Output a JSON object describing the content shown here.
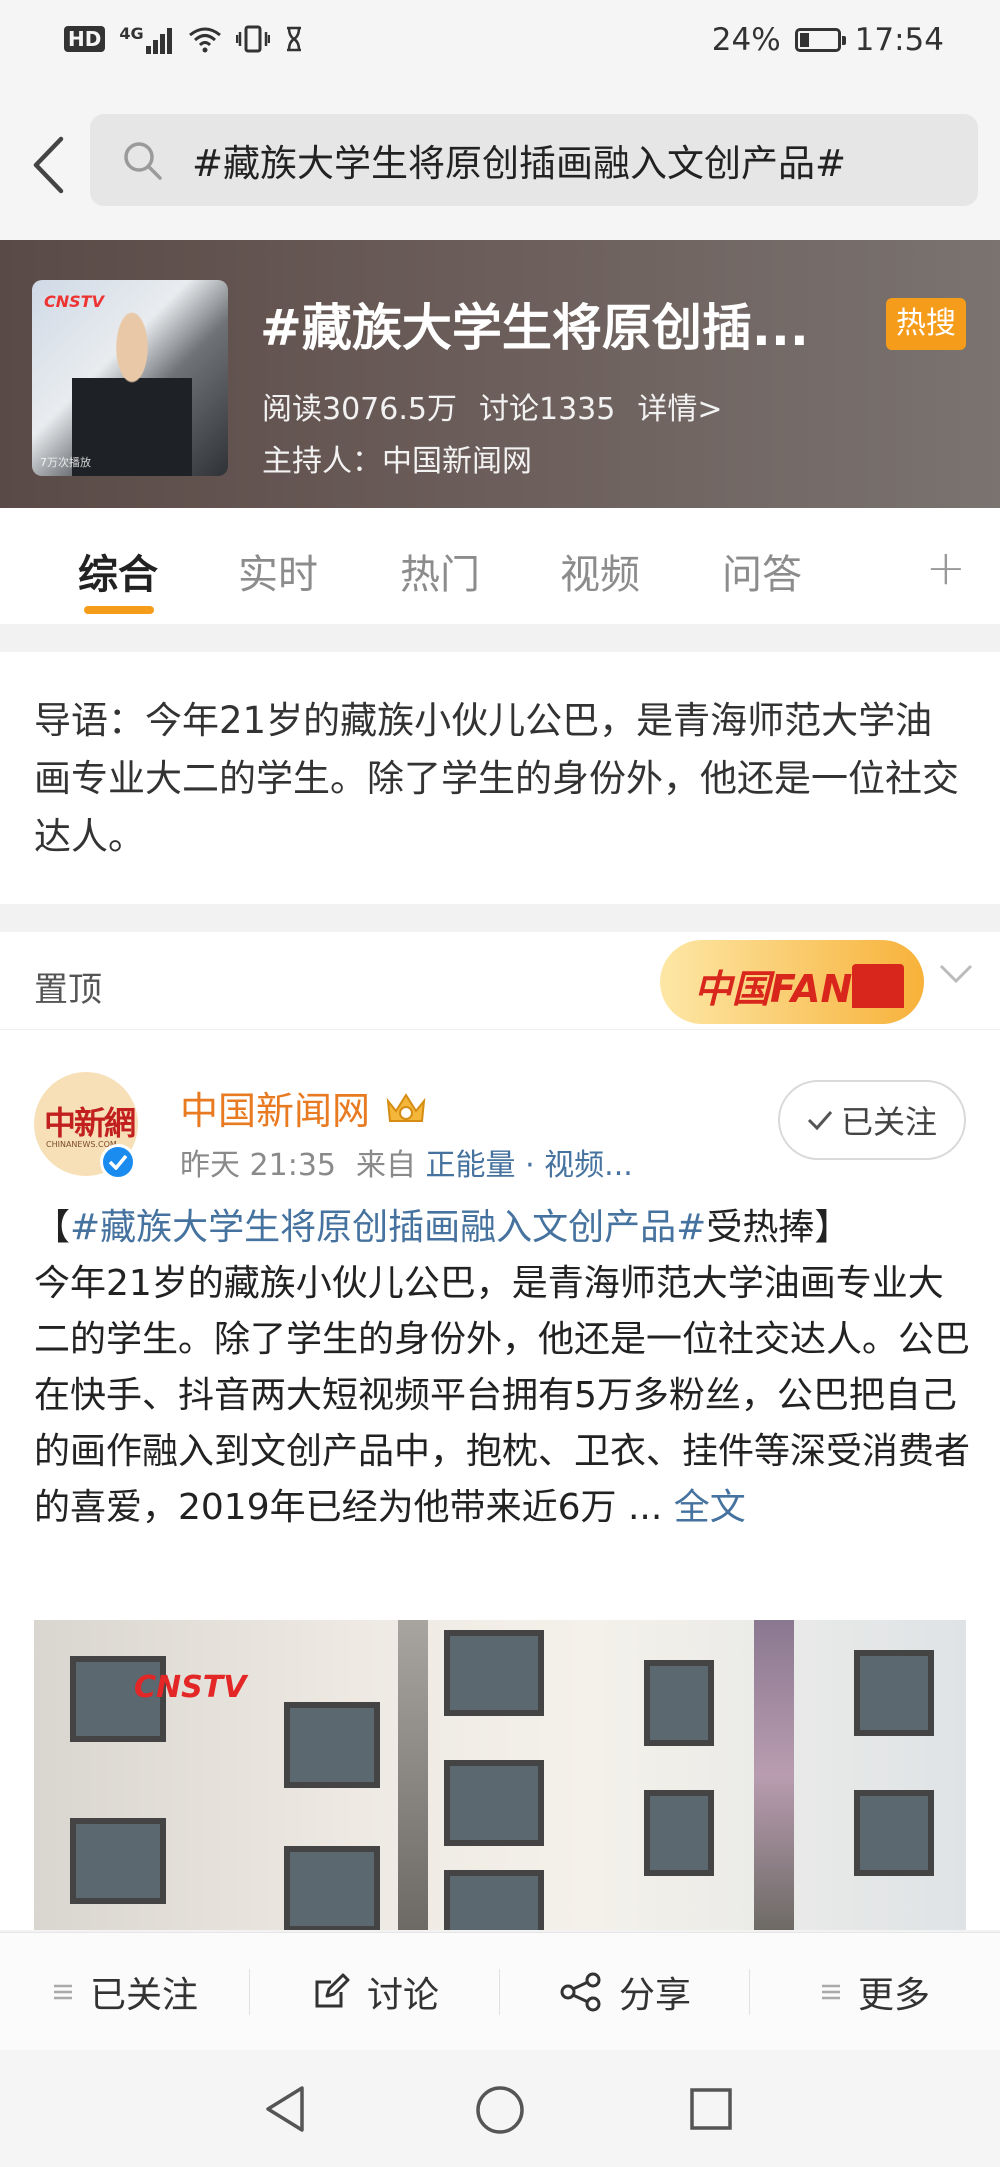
{
  "status_bar": {
    "network": "4G",
    "hd": "HD",
    "battery": "24%",
    "battery_level": 0.24,
    "time": "17:54"
  },
  "search": {
    "query": "#藏族大学生将原创插画融入文创产品#"
  },
  "topic": {
    "title": "#藏族大学生将原创插...",
    "badge": "热搜",
    "reads": "阅读3076.5万",
    "discussions": "讨论1335",
    "details": "详情>",
    "host": "主持人：中国新闻网",
    "thumb_logo": "CNSTV",
    "thumb_caption": "7万次播放"
  },
  "tabs": [
    {
      "label": "综合",
      "active": true
    },
    {
      "label": "实时",
      "active": false
    },
    {
      "label": "热门",
      "active": false
    },
    {
      "label": "视频",
      "active": false
    },
    {
      "label": "问答",
      "active": false
    }
  ],
  "tab_more": "+",
  "intro": {
    "text": "导语：今年21岁的藏族小伙儿公巴，是青海师范大学油画专业大二的学生。除了学生的身份外，他还是一位社交达人。"
  },
  "pinned": {
    "label": "置顶",
    "fans_banner": "中国FANS"
  },
  "post": {
    "avatar_text": "中新網",
    "avatar_sub": "CHINANEWS.COM",
    "author": "中国新闻网",
    "time": "昨天 21:35",
    "from_label": "来自",
    "source": "正能量 · 视频...",
    "follow_label": "已关注",
    "bracket_open": "【",
    "hashtag": "#藏族大学生将原创插画融入文创产品#",
    "headline_tail": "受热捧】",
    "body": "今年21岁的藏族小伙儿公巴，是青海师范大学油画专业大二的学生。除了学生的身份外，他还是一位社交达人。公巴在快手、抖音两大短视频平台拥有5万多粉丝，公巴把自己的画作融入到文创产品中，抱枕、卫衣、挂件等深受消费者的喜爱，2019年已经为他带来近6万 ...",
    "more_link": "全文",
    "image_logo": "CNSTV"
  },
  "actions": [
    {
      "label": "已关注",
      "icon": "menu-icon"
    },
    {
      "label": "讨论",
      "icon": "edit-icon"
    },
    {
      "label": "分享",
      "icon": "share-icon"
    },
    {
      "label": "更多",
      "icon": "menu-icon"
    }
  ],
  "colors": {
    "accent": "#f59c1b",
    "link": "#45729e",
    "author": "#e87a22",
    "verified": "#1a8cf0"
  }
}
